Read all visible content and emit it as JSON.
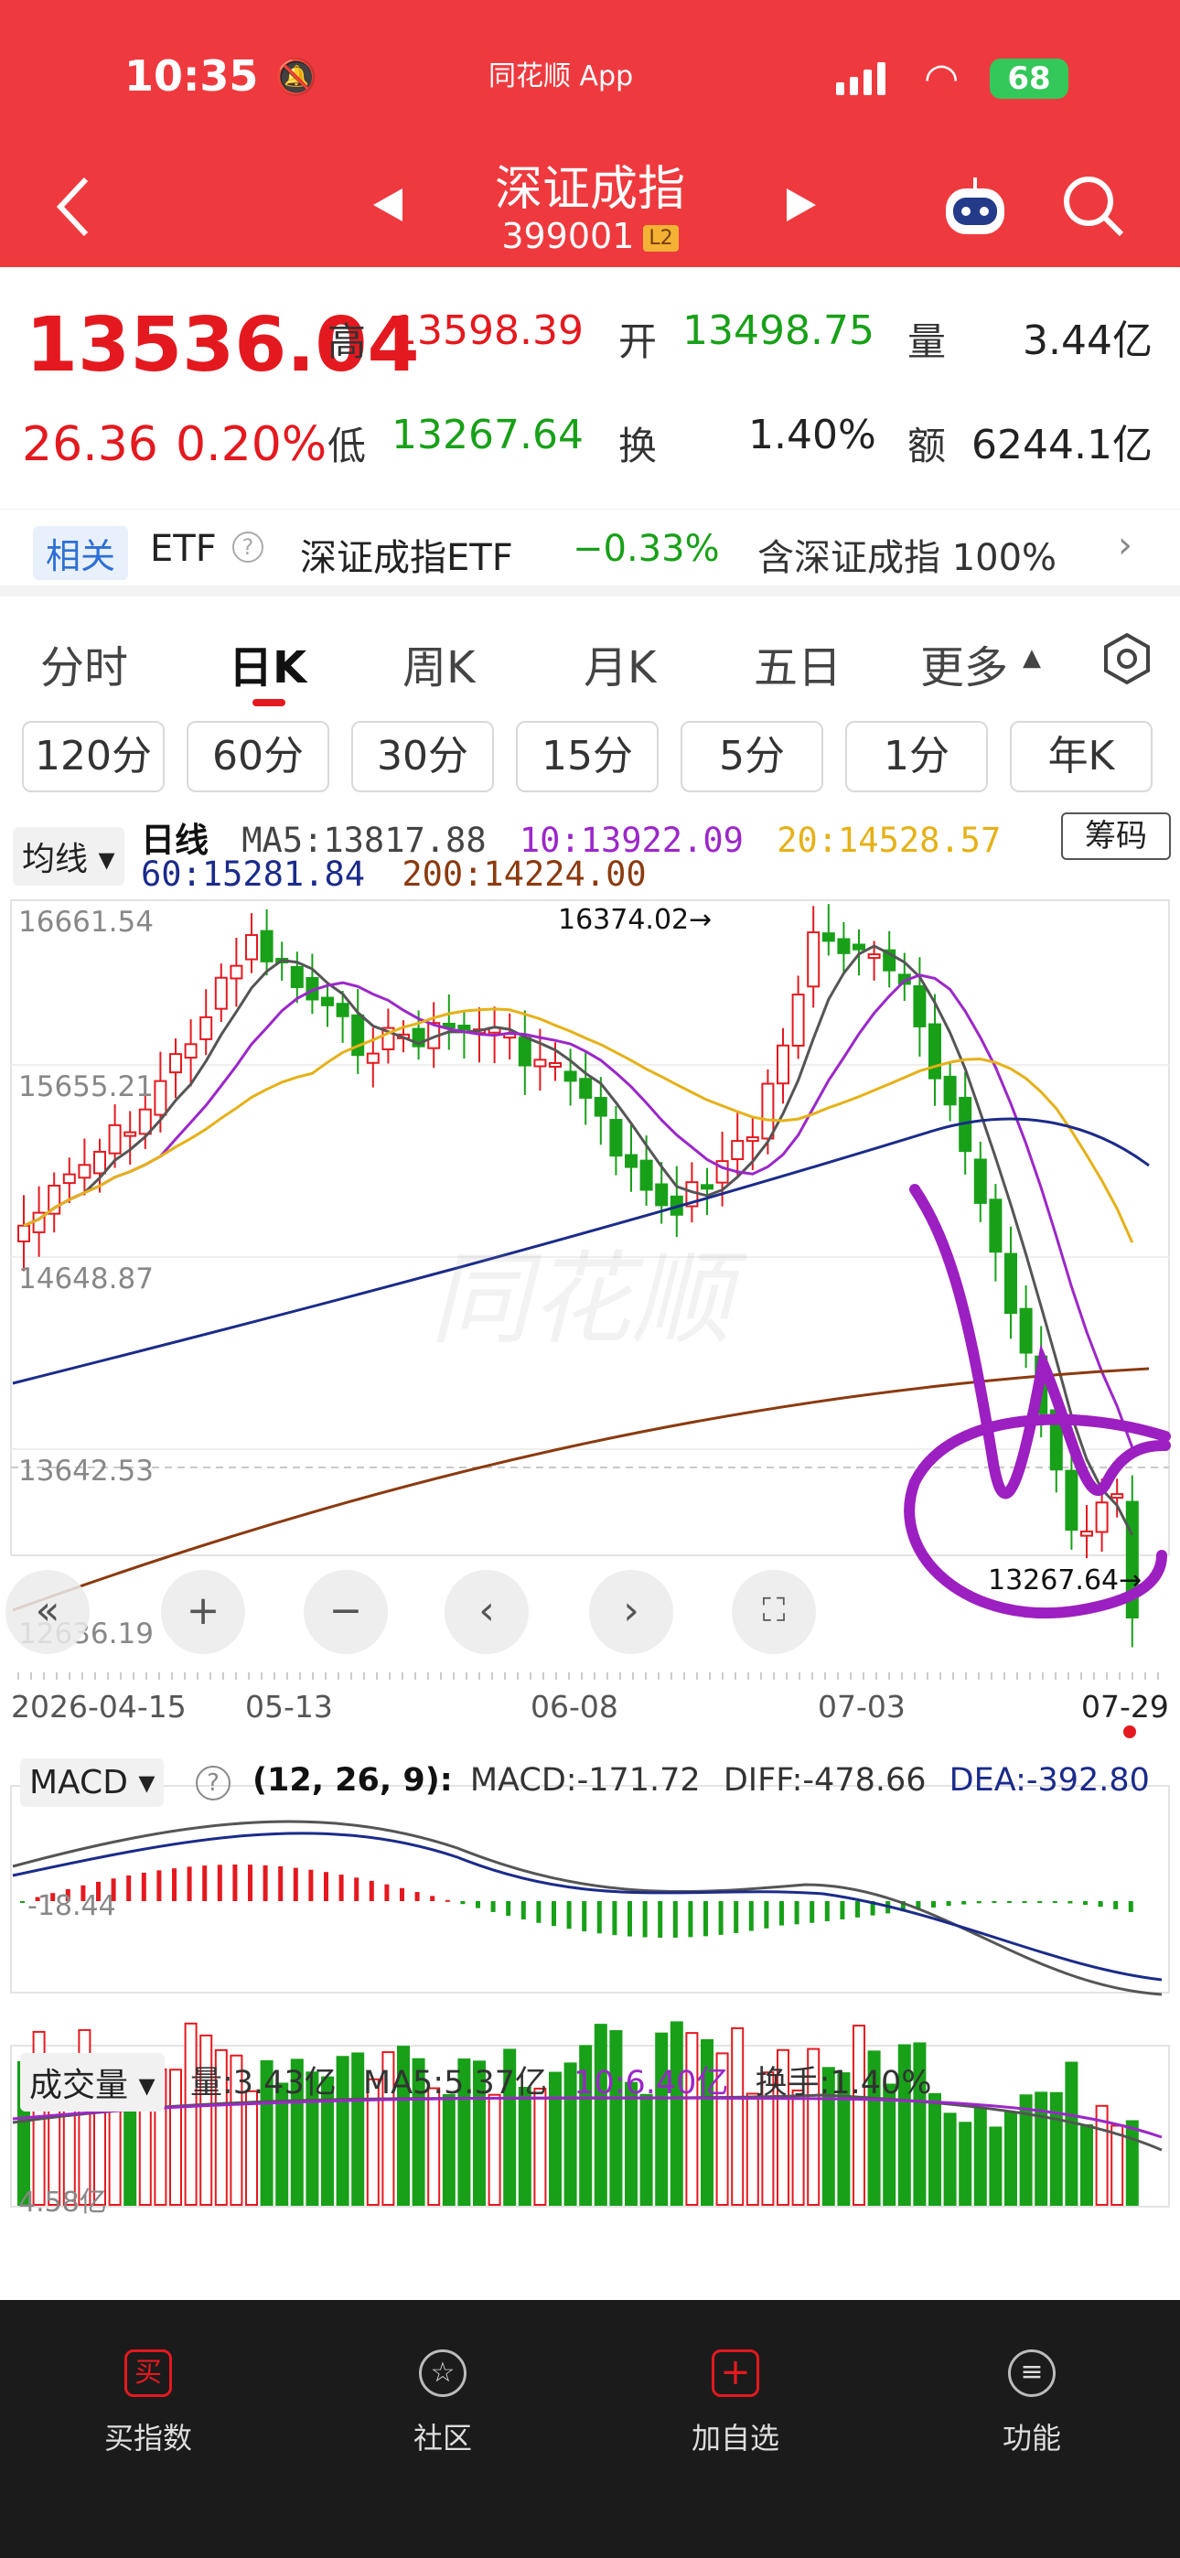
{
  "status": {
    "time": "10:35",
    "app": "同花顺 App",
    "battery": "68"
  },
  "header": {
    "title": "深证成指",
    "code": "399001",
    "badge": "L2"
  },
  "quote": {
    "price": "13536.04",
    "change": "26.36",
    "change_pct": "0.20%",
    "high_label": "高",
    "high": "13598.39",
    "low_label": "低",
    "low": "13267.64",
    "open_label": "开",
    "open": "13498.75",
    "turnover_label": "换",
    "turnover": "1.40%",
    "volume_label": "量",
    "volume": "3.44亿",
    "amount_label": "额",
    "amount": "6244.1亿"
  },
  "etf": {
    "tag": "相关",
    "etf_label": "ETF",
    "name": "深证成指ETF",
    "change": "−0.33%",
    "contains": "含深证成指 100%"
  },
  "tabs": [
    "分时",
    "日K",
    "周K",
    "月K",
    "五日",
    "更多"
  ],
  "periods": [
    "120分",
    "60分",
    "30分",
    "15分",
    "5分",
    "1分",
    "年K"
  ],
  "ma_legend": {
    "dropdown": "均线",
    "type": "日线",
    "ma5": "MA5:13817.88",
    "ma10": "10:13922.09",
    "ma20": "20:14528.57",
    "ma60": "60:15281.84",
    "ma200": "200:14224.00",
    "chip_btn": "筹码"
  },
  "price_axis": [
    "16661.54",
    "15655.21",
    "14648.87",
    "13642.53",
    "12636.19"
  ],
  "annotations": {
    "high": "16374.02→",
    "low": "13267.64→"
  },
  "date_axis": [
    "2026-04-15",
    "05-13",
    "06-08",
    "07-03",
    "07-29"
  ],
  "macd": {
    "dropdown": "MACD",
    "params": "(12, 26, 9):",
    "macd": "MACD:-171.72",
    "diff": "DIFF:-478.66",
    "dea": "DEA:-392.80",
    "axis_label": "-18.44"
  },
  "vol": {
    "dropdown": "成交量",
    "vol": "量:3.43亿",
    "ma5": "MA5:5.37亿",
    "ma10": "10:6.40亿",
    "turnover": "换手:1.40%",
    "axis_label": "4.58亿"
  },
  "watermark": "同花顺",
  "nav": [
    "买指数",
    "社区",
    "加自选",
    "功能"
  ],
  "colors": {
    "up": "#e4191f",
    "down": "#18a018",
    "ma5": "#555555",
    "ma10": "#9b27c9",
    "ma20": "#e5b117",
    "ma60": "#1b2b8a",
    "ma200": "#8b3a0f",
    "marker": "#9c1fc1"
  },
  "icons": {
    "back": "chevron-left-icon",
    "prev": "triangle-left-icon",
    "next": "triangle-right-icon",
    "robot": "robot-icon",
    "search": "search-icon",
    "settings": "hexagon-gear-icon"
  }
}
